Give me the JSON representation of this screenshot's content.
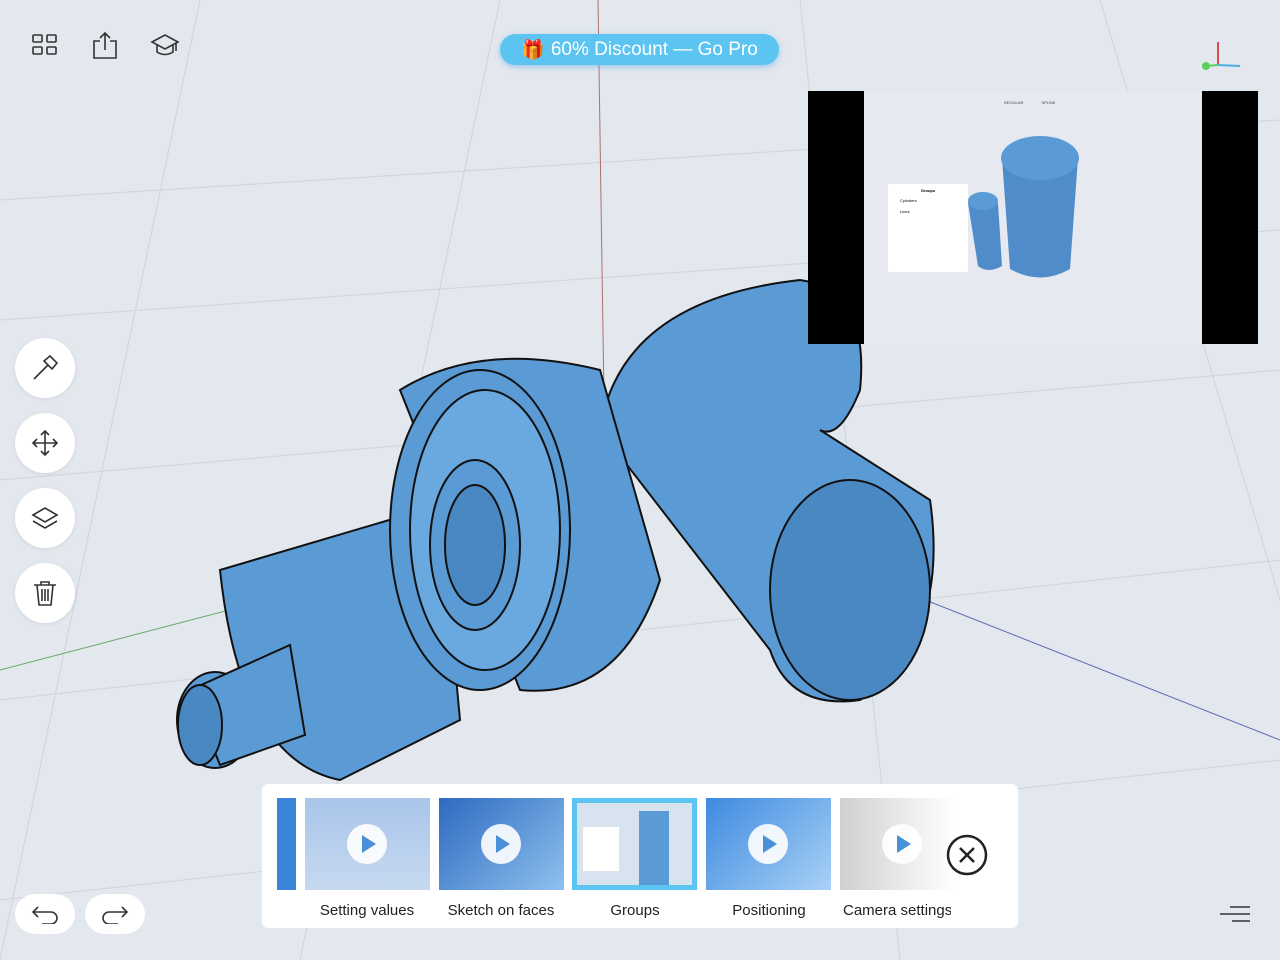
{
  "toolbar": {
    "icons": [
      "grid-icon",
      "share-icon",
      "graduation-cap-icon"
    ]
  },
  "promo": {
    "emoji": "🎁",
    "label": "60% Discount — Go Pro"
  },
  "sidebar": {
    "tools": [
      "hammer-icon",
      "move-icon",
      "layers-icon",
      "trash-icon"
    ]
  },
  "preview": {
    "tabs": [
      "REGULAR",
      "SPLINE"
    ],
    "panel_title": "Groups",
    "groups": [
      "Cylinders",
      "Lines"
    ]
  },
  "tutorials": {
    "items": [
      {
        "label": "Setting values"
      },
      {
        "label": "Sketch on faces"
      },
      {
        "label": "Groups",
        "selected": true
      },
      {
        "label": "Positioning"
      },
      {
        "label": "Camera settings"
      }
    ]
  },
  "colors": {
    "model": "#5b9bd5",
    "promo": "#5bc4f0",
    "background": "#e3e7ee"
  }
}
